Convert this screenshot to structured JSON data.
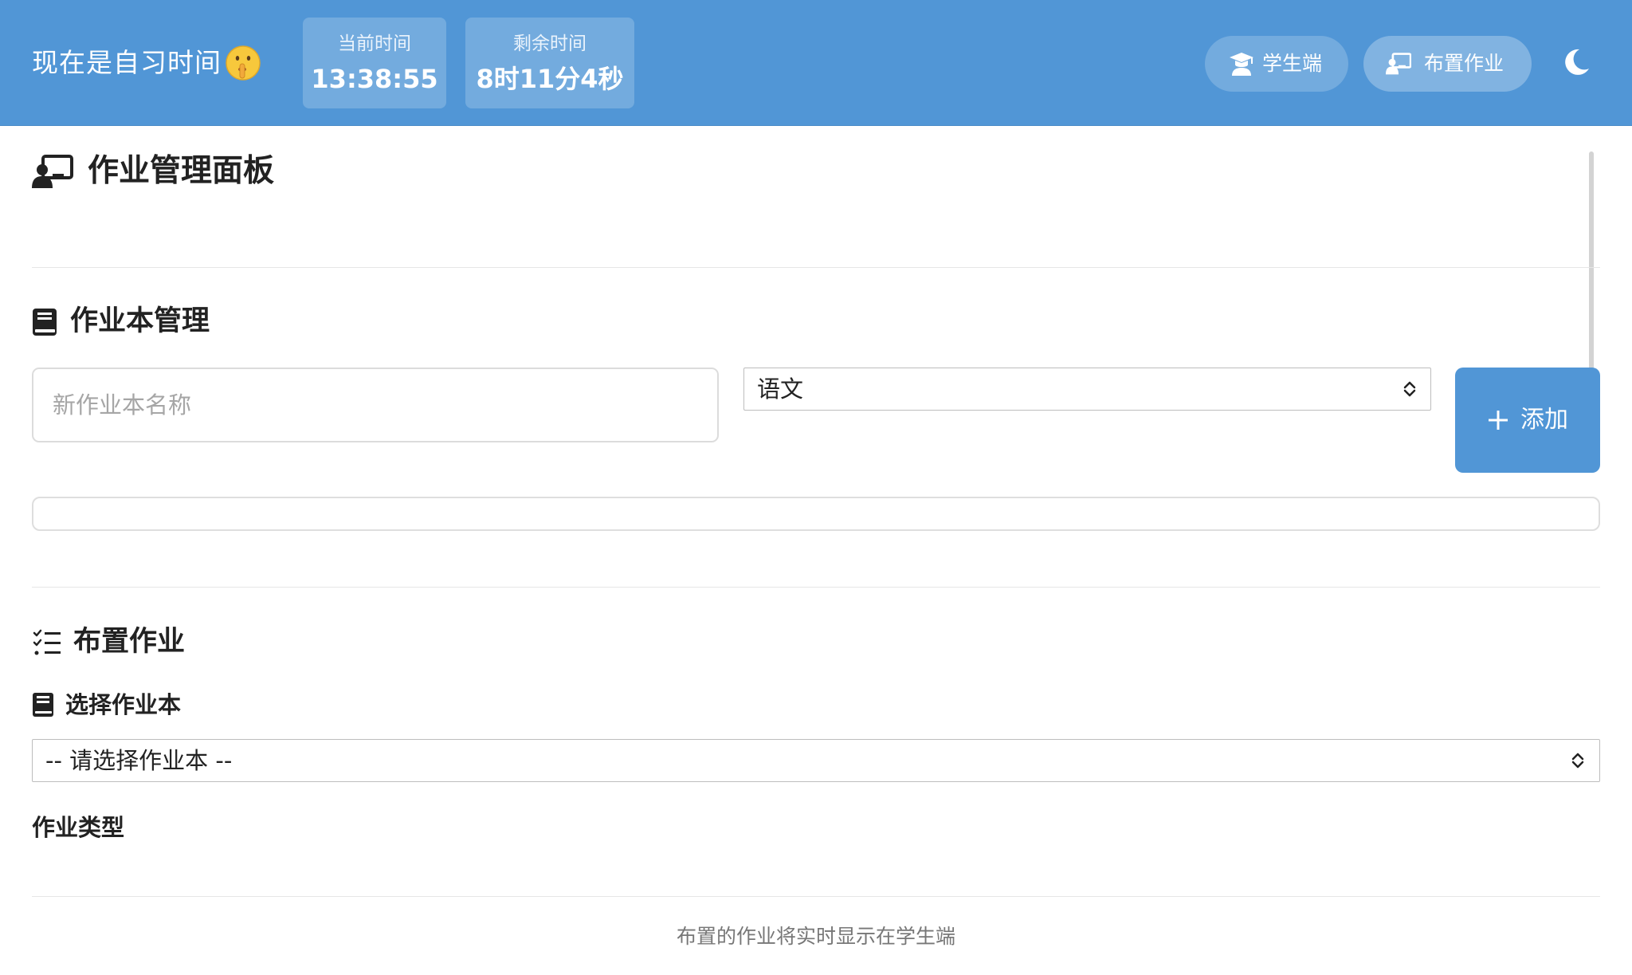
{
  "header": {
    "status_text": "现在是自习时间",
    "status_emoji_icon": "shushing-face-icon",
    "current_time": {
      "label": "当前时间",
      "value": "13:38:55"
    },
    "remaining_time": {
      "label": "剩余时间",
      "value": "8时11分4秒"
    },
    "nav": {
      "student_label": "学生端",
      "assign_label": "布置作业"
    },
    "theme_toggle_icon": "moon-icon"
  },
  "panel": {
    "title": "作业管理面板"
  },
  "notebook_manager": {
    "title": "作业本管理",
    "name_placeholder": "新作业本名称",
    "name_value": "",
    "subject_selected": "语文",
    "add_label": "添加"
  },
  "assign": {
    "title": "布置作业",
    "choose_notebook_label": "选择作业本",
    "notebook_selected": "-- 请选择作业本 --",
    "homework_type_label": "作业类型"
  },
  "footer": {
    "note": "布置的作业将实时显示在学生端"
  },
  "colors": {
    "primary": "#5196d6",
    "text": "#222222",
    "muted": "#777777",
    "border": "#dcdcdc"
  }
}
